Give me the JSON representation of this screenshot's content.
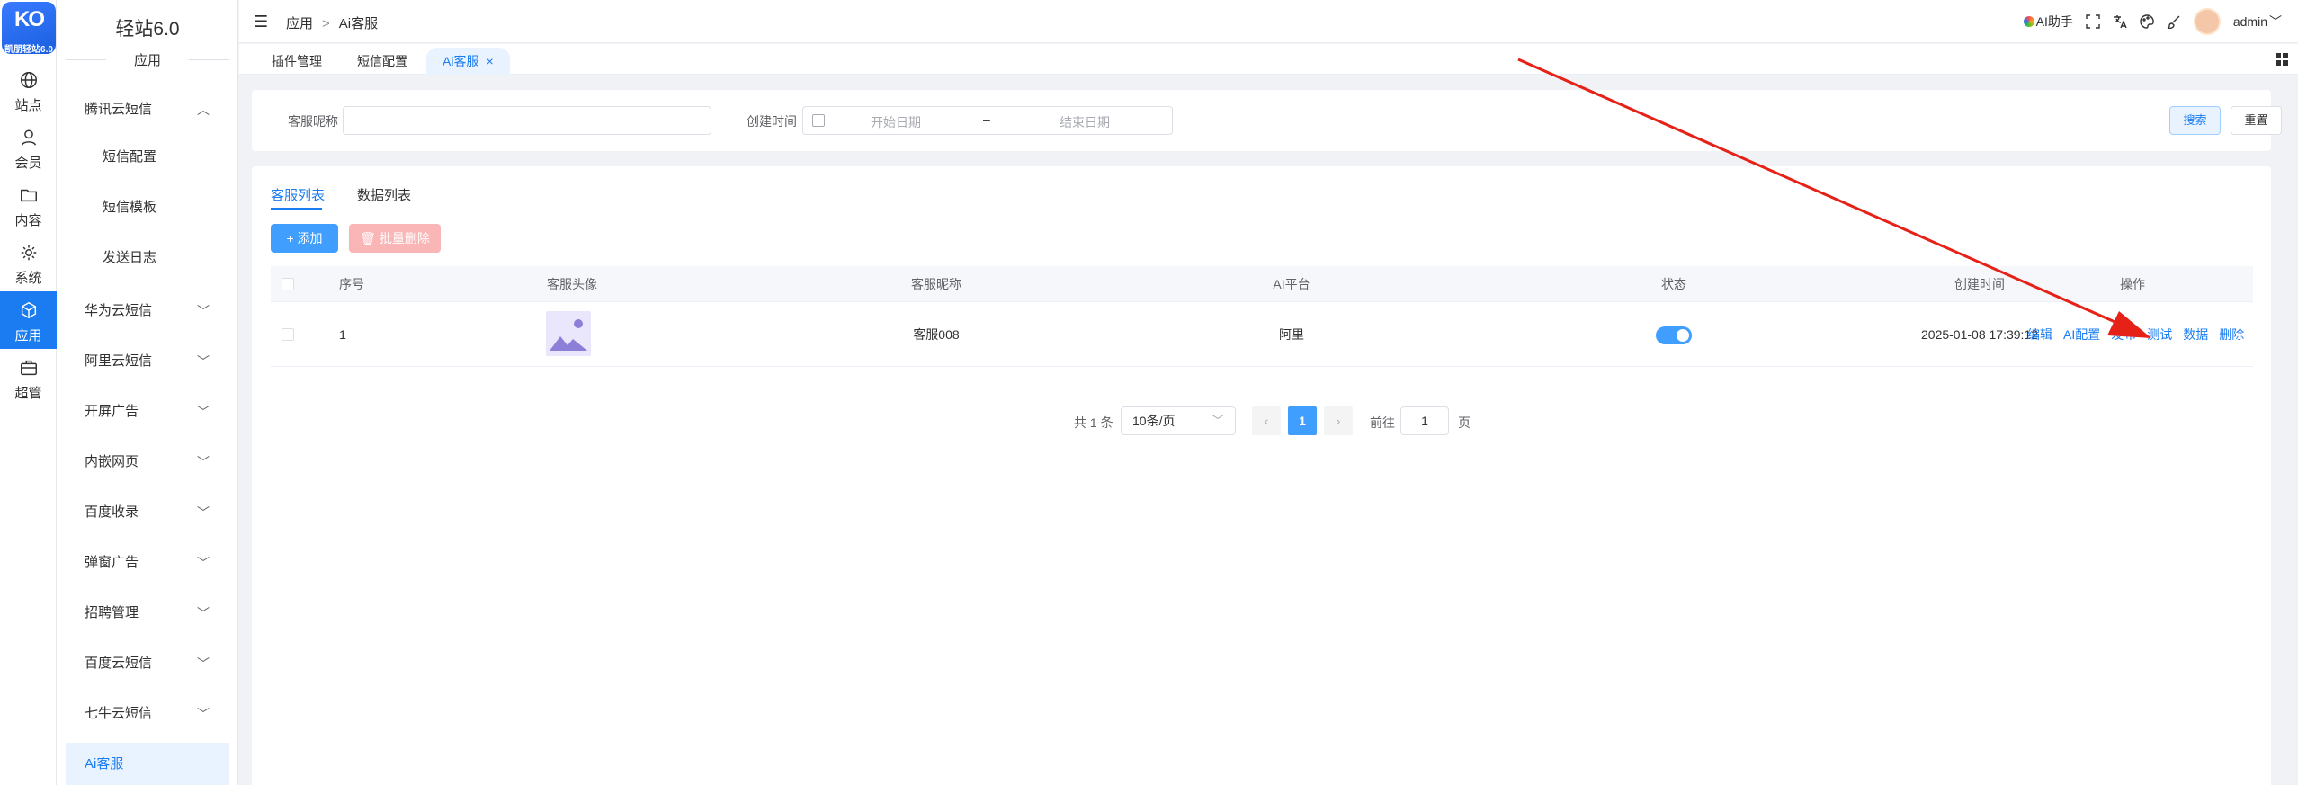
{
  "brand": {
    "mark": "KO",
    "text": "凯朋轻站6.0"
  },
  "rail": [
    {
      "label": "站点",
      "icon": "globe-icon"
    },
    {
      "label": "会员",
      "icon": "user-icon"
    },
    {
      "label": "内容",
      "icon": "folder-icon"
    },
    {
      "label": "系统",
      "icon": "gear-icon"
    },
    {
      "label": "应用",
      "icon": "cube-icon",
      "active": true
    },
    {
      "label": "超管",
      "icon": "briefcase-icon"
    }
  ],
  "sidebar": {
    "title": "轻站6.0",
    "subtitle": "应用",
    "items": [
      {
        "label": "腾讯云短信",
        "expanded": true
      },
      {
        "label": "短信配置",
        "sub": true
      },
      {
        "label": "短信模板",
        "sub": true
      },
      {
        "label": "发送日志",
        "sub": true
      },
      {
        "label": "华为云短信"
      },
      {
        "label": "阿里云短信"
      },
      {
        "label": "开屏广告"
      },
      {
        "label": "内嵌网页"
      },
      {
        "label": "百度收录"
      },
      {
        "label": "弹窗广告"
      },
      {
        "label": "招聘管理"
      },
      {
        "label": "百度云短信"
      },
      {
        "label": "七牛云短信"
      },
      {
        "label": "Ai客服",
        "active": true
      }
    ]
  },
  "header": {
    "breadcrumb": [
      "应用",
      "Ai客服"
    ],
    "separator": ">",
    "ai_assistant": "AI助手",
    "user": "admin"
  },
  "tabs": [
    {
      "label": "插件管理"
    },
    {
      "label": "短信配置"
    },
    {
      "label": "Ai客服",
      "active": true,
      "close": "×"
    }
  ],
  "search": {
    "nickname_label": "客服昵称",
    "nickname_value": "",
    "created_label": "创建时间",
    "start_placeholder": "开始日期",
    "end_placeholder": "结束日期",
    "range_sep": "–",
    "search_btn": "搜索",
    "reset_btn": "重置"
  },
  "main": {
    "tabs": [
      {
        "label": "客服列表",
        "active": true
      },
      {
        "label": "数据列表"
      }
    ],
    "add_btn": "+ 添加",
    "bulk_delete_btn": "批量删除",
    "columns": [
      "序号",
      "客服头像",
      "客服昵称",
      "AI平台",
      "状态",
      "创建时间",
      "操作"
    ],
    "rows": [
      {
        "index": "1",
        "nickname": "客服008",
        "platform": "阿里",
        "status_on": true,
        "created": "2025-01-08 17:39:12",
        "actions": [
          "编辑",
          "AI配置",
          "发布",
          "测试",
          "数据",
          "删除"
        ]
      }
    ]
  },
  "pagination": {
    "total": "共 1 条",
    "page_size": "10条/页",
    "current": "1",
    "prev": "‹",
    "next": "›",
    "goto_label": "前往",
    "goto_value": "1",
    "page_suffix": "页"
  },
  "colors": {
    "accent": "#1a7cf0",
    "danger_light": "#fab6b6",
    "annotation": "#e62117"
  }
}
